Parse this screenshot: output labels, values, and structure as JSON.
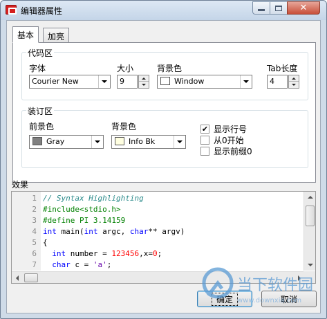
{
  "window": {
    "title": "编辑器属性"
  },
  "tabs": [
    {
      "label": "基本",
      "active": true
    },
    {
      "label": "加亮",
      "active": false
    }
  ],
  "code_group": {
    "title": "代码区",
    "font_label": "字体",
    "font_value": "Courier New",
    "size_label": "大小",
    "size_value": "9",
    "bg_label": "背景色",
    "bg_value": "Window",
    "tab_label": "Tab长度",
    "tab_value": "4"
  },
  "gutter_group": {
    "title": "装订区",
    "fg_label": "前景色",
    "fg_value": "Gray",
    "fg_color": "#808080",
    "bg_label": "背景色",
    "bg_value": "Info Bk",
    "bg_color": "#ffffe1",
    "options": [
      {
        "label": "显示行号",
        "checked": true
      },
      {
        "label": "从0开始",
        "checked": false
      },
      {
        "label": "显示前缀0",
        "checked": false
      }
    ]
  },
  "preview": {
    "label": "效果",
    "lines": [
      {
        "n": "1",
        "tokens": [
          {
            "t": "// Syntax Highlighting",
            "c": "comment"
          }
        ]
      },
      {
        "n": "2",
        "tokens": [
          {
            "t": "#include<stdio.h>",
            "c": "pre"
          }
        ]
      },
      {
        "n": "3",
        "tokens": [
          {
            "t": "#define PI 3.14159",
            "c": "pre"
          }
        ]
      },
      {
        "n": "4",
        "tokens": [
          {
            "t": "int",
            "c": "kw"
          },
          {
            "t": " main(",
            "c": ""
          },
          {
            "t": "int",
            "c": "kw"
          },
          {
            "t": " argc, ",
            "c": ""
          },
          {
            "t": "char",
            "c": "kw"
          },
          {
            "t": "** argv)",
            "c": ""
          }
        ]
      },
      {
        "n": "5",
        "tokens": [
          {
            "t": "{",
            "c": ""
          }
        ]
      },
      {
        "n": "6",
        "tokens": [
          {
            "t": "  ",
            "c": ""
          },
          {
            "t": "int",
            "c": "kw"
          },
          {
            "t": " number = ",
            "c": ""
          },
          {
            "t": "123456",
            "c": "num"
          },
          {
            "t": ",x=",
            "c": ""
          },
          {
            "t": "0",
            "c": "num"
          },
          {
            "t": ";",
            "c": ""
          }
        ]
      },
      {
        "n": "7",
        "tokens": [
          {
            "t": "  ",
            "c": ""
          },
          {
            "t": "char",
            "c": "kw"
          },
          {
            "t": " c = ",
            "c": ""
          },
          {
            "t": "'a'",
            "c": "str"
          },
          {
            "t": ";",
            "c": ""
          }
        ]
      }
    ]
  },
  "buttons": {
    "ok": "确定",
    "cancel": "取消"
  },
  "watermark": {
    "text": "当下软件园",
    "url": "www.downxia.com"
  }
}
